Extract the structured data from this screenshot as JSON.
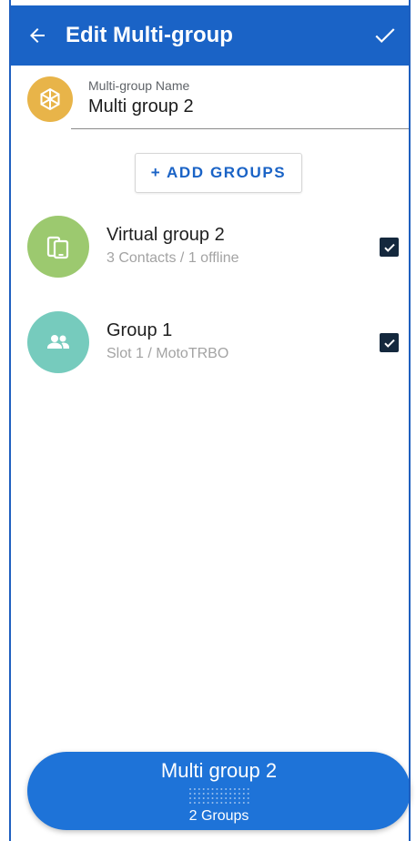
{
  "appbar": {
    "title": "Edit Multi-group",
    "back_icon": "arrow-left-icon",
    "confirm_icon": "check-icon",
    "background": "#1a63c6"
  },
  "name_field": {
    "label": "Multi-group Name",
    "value": "Multi group 2",
    "icon": "network-icon",
    "icon_color": "#e8b449"
  },
  "add_button": {
    "label": "+ ADD GROUPS"
  },
  "groups": [
    {
      "name": "Virtual group 2",
      "subtitle": "3 Contacts / 1 offline",
      "icon": "devices-icon",
      "color": "#9cc96f",
      "checked": true
    },
    {
      "name": "Group 1",
      "subtitle": "Slot 1 / MotoTRBO",
      "icon": "people-icon",
      "color": "#76cbbd",
      "checked": true
    }
  ],
  "summary": {
    "name": "Multi group 2",
    "count": "2 Groups",
    "background": "#1e73d8"
  }
}
